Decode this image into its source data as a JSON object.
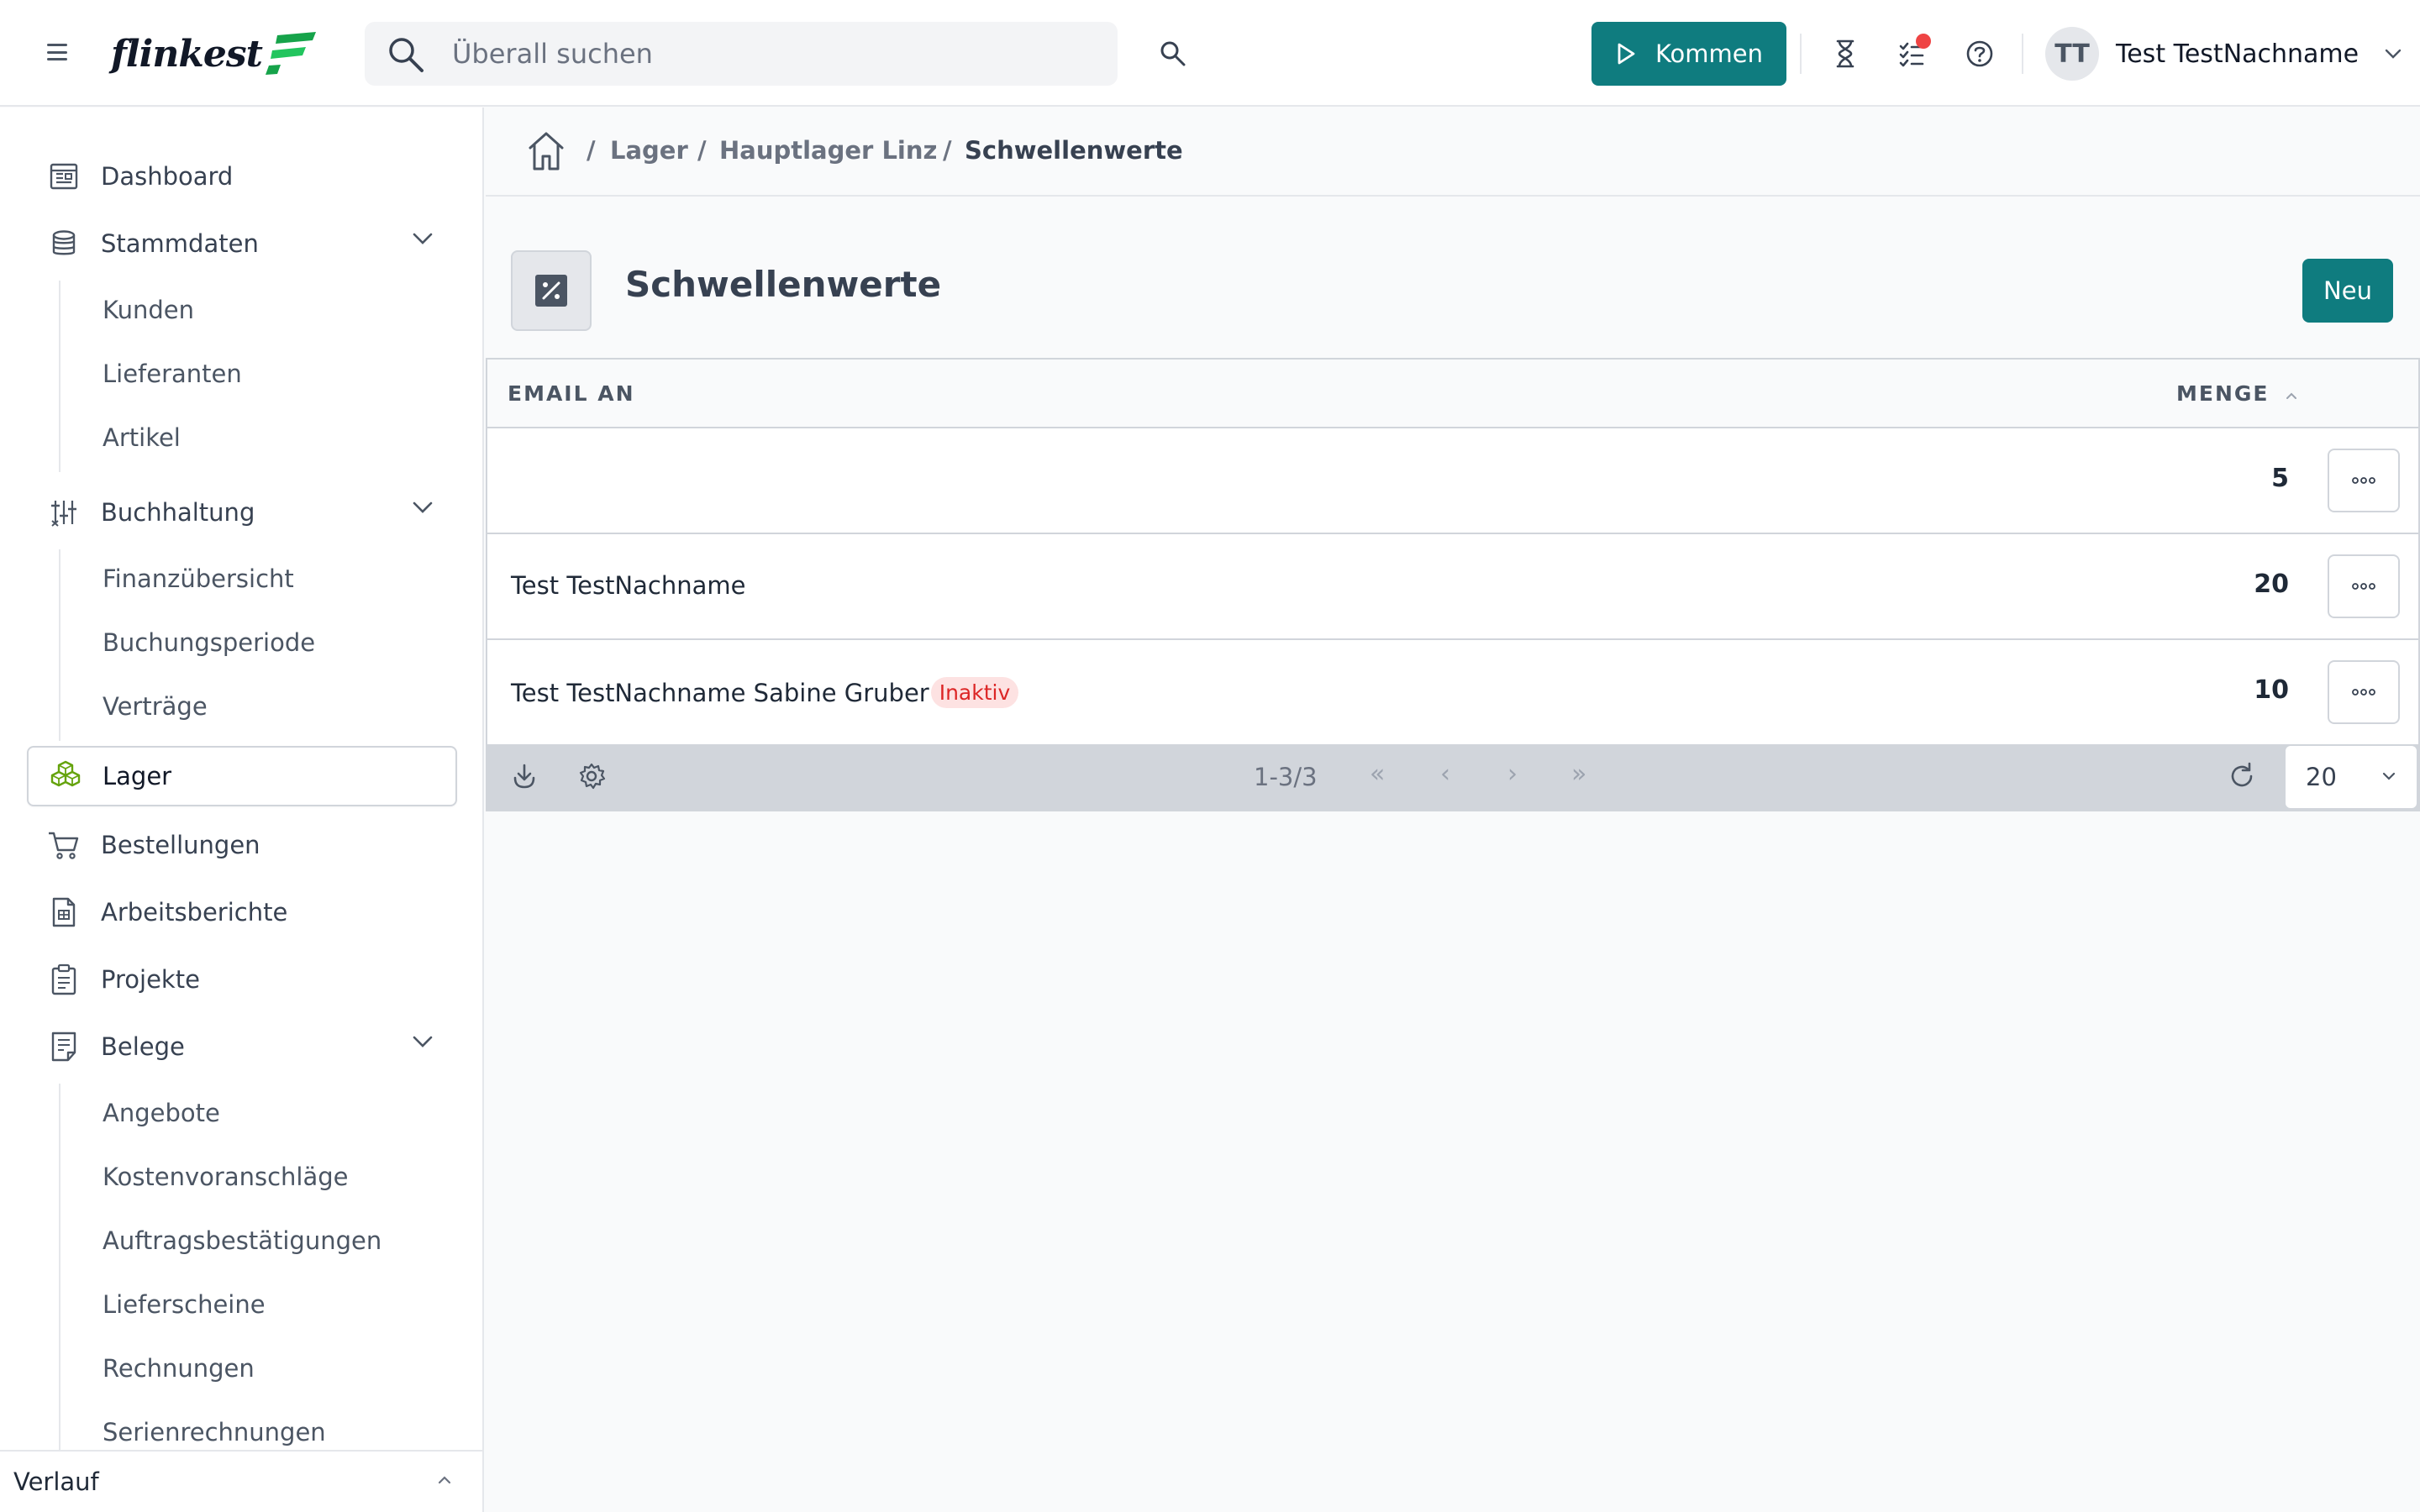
{
  "header": {
    "logo_text": "flinkest",
    "search_placeholder": "Überall suchen",
    "kommen_label": "Kommen",
    "user_initials": "TT",
    "user_name": "Test TestNachname",
    "accent_color": "#0f7c7f",
    "icons": [
      "hamburger-icon",
      "search-icon",
      "play-icon",
      "hourglass-icon",
      "tasks-icon",
      "help-icon",
      "chevron-down-icon"
    ]
  },
  "sidebar": {
    "items": [
      {
        "label": "Dashboard",
        "icon": "dashboard-icon"
      },
      {
        "label": "Stammdaten",
        "icon": "database-icon",
        "expanded": true
      },
      {
        "label": "Buchhaltung",
        "icon": "sliders-icon",
        "expanded": true
      },
      {
        "label": "Lager",
        "icon": "boxes-icon",
        "active": true
      },
      {
        "label": "Bestellungen",
        "icon": "cart-icon"
      },
      {
        "label": "Arbeitsberichte",
        "icon": "report-icon"
      },
      {
        "label": "Projekte",
        "icon": "clipboard-icon"
      },
      {
        "label": "Belege",
        "icon": "document-icon",
        "expanded": true
      }
    ],
    "stammdaten_sub": [
      "Kunden",
      "Lieferanten",
      "Artikel"
    ],
    "buchhaltung_sub": [
      "Finanzübersicht",
      "Buchungsperiode",
      "Verträge"
    ],
    "belege_sub": [
      "Angebote",
      "Kostenvoranschläge",
      "Auftragsbestätigungen",
      "Lieferscheine",
      "Rechnungen",
      "Serienrechnungen"
    ],
    "verlauf_label": "Verlauf"
  },
  "breadcrumb": {
    "sep": "/",
    "items": [
      "Lager",
      "Hauptlager Linz",
      "Schwellenwerte"
    ]
  },
  "page": {
    "title": "Schwellenwerte",
    "new_button": "Neu",
    "icon": "percent-icon"
  },
  "table": {
    "columns": {
      "email": "EMAIL AN",
      "menge": "MENGE"
    },
    "rows": [
      {
        "email": "",
        "badge": "",
        "menge": "5"
      },
      {
        "email": "Test TestNachname",
        "badge": "",
        "menge": "20"
      },
      {
        "email": "Test TestNachname Sabine Gruber",
        "badge": "Inaktiv",
        "menge": "10"
      }
    ],
    "footer": {
      "range": "1-3/3",
      "first": "«",
      "prev": "‹",
      "next": "›",
      "last": "»",
      "page_size": "20"
    }
  }
}
